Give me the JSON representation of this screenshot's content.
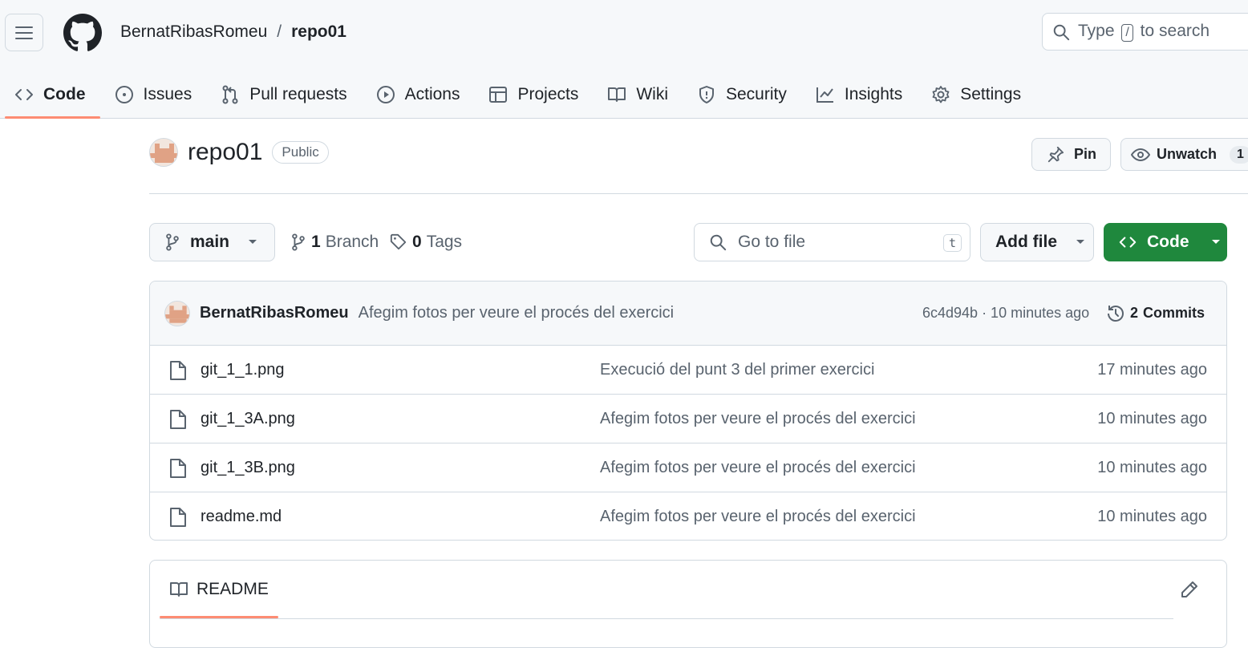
{
  "header": {
    "owner": "BernatRibasRomeu",
    "separator": "/",
    "repo": "repo01",
    "search_prefix": "Type",
    "search_key": "/",
    "search_suffix": "to search"
  },
  "tabs": [
    {
      "label": "Code",
      "icon": "code-icon",
      "active": true
    },
    {
      "label": "Issues",
      "icon": "issue-icon"
    },
    {
      "label": "Pull requests",
      "icon": "pull-request-icon"
    },
    {
      "label": "Actions",
      "icon": "play-icon"
    },
    {
      "label": "Projects",
      "icon": "table-icon"
    },
    {
      "label": "Wiki",
      "icon": "book-icon"
    },
    {
      "label": "Security",
      "icon": "shield-icon"
    },
    {
      "label": "Insights",
      "icon": "graph-icon"
    },
    {
      "label": "Settings",
      "icon": "gear-icon"
    }
  ],
  "repo": {
    "name": "repo01",
    "visibility": "Public",
    "pin_label": "Pin",
    "watch_label": "Unwatch",
    "watch_count": "1"
  },
  "toolbar": {
    "branch": "main",
    "branch_count": "1",
    "branch_label": "Branch",
    "tag_count": "0",
    "tag_label": "Tags",
    "gofile_placeholder": "Go to file",
    "gofile_key": "t",
    "add_file": "Add file",
    "code": "Code"
  },
  "latest_commit": {
    "author": "BernatRibasRomeu",
    "message": "Afegim fotos per veure el procés del exercici",
    "meta": "6c4d94b · 10 minutes ago",
    "commits_count": "2",
    "commits_label": "Commits"
  },
  "files": [
    {
      "name": "git_1_1.png",
      "message": "Execució del punt 3 del primer exercici",
      "time": "17 minutes ago"
    },
    {
      "name": "git_1_3A.png",
      "message": "Afegim fotos per veure el procés del exercici",
      "time": "10 minutes ago"
    },
    {
      "name": "git_1_3B.png",
      "message": "Afegim fotos per veure el procés del exercici",
      "time": "10 minutes ago"
    },
    {
      "name": "readme.md",
      "message": "Afegim fotos per veure el procés del exercici",
      "time": "10 minutes ago"
    }
  ],
  "readme": {
    "label": "README"
  },
  "colors": {
    "accent_underline": "#fd8c73",
    "code_button": "#1f883d",
    "muted": "#59636e",
    "border": "#d1d9e0"
  }
}
